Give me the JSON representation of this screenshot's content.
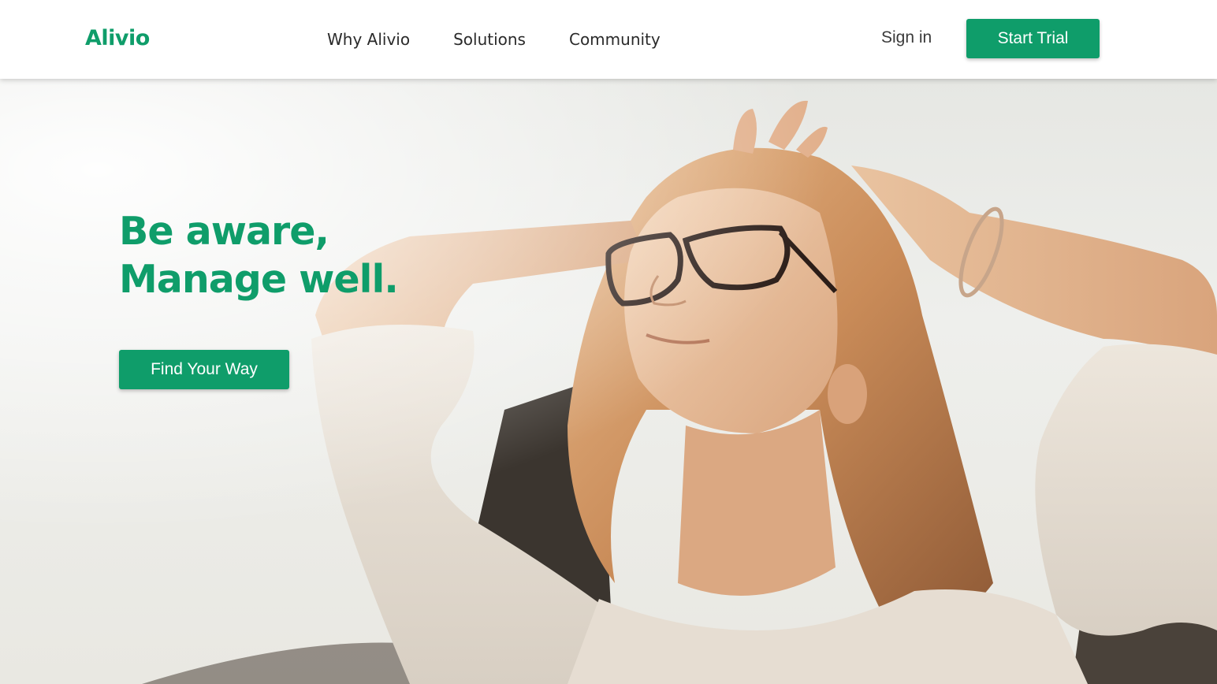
{
  "brand": {
    "name": "Alivio",
    "accent_color": "#0f9d6a"
  },
  "nav": {
    "items": [
      {
        "label": "Why Alivio"
      },
      {
        "label": "Solutions"
      },
      {
        "label": "Community"
      }
    ]
  },
  "header": {
    "signin_label": "Sign in",
    "cta_label": "Start Trial"
  },
  "hero": {
    "headline": "Be aware, Manage well.",
    "cta_label": "Find Your Way",
    "image_subject": "woman-with-glasses-sunlight-photo"
  }
}
